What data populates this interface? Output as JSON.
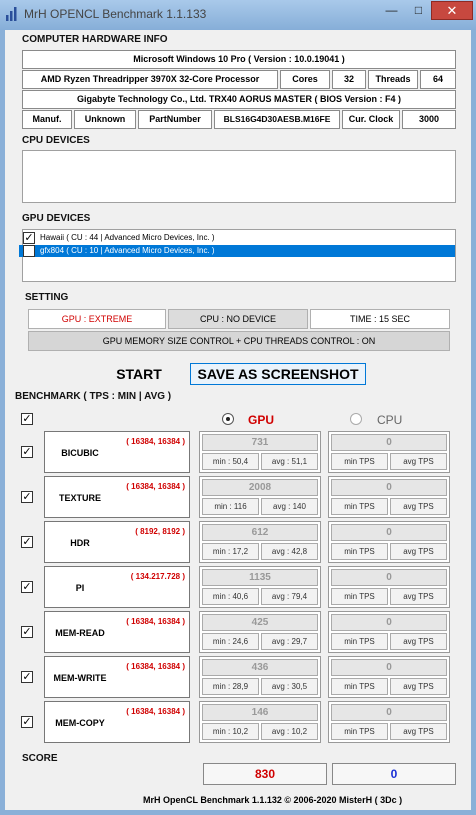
{
  "window": {
    "title": "MrH OPENCL Benchmark 1.1.133",
    "minimize": "—",
    "maximize": "□",
    "close": "✕"
  },
  "hardware": {
    "header": "COMPUTER HARDWARE INFO",
    "os": "Microsoft Windows 10 Pro ( Version : 10.0.19041 )",
    "cpu_name": "AMD Ryzen Threadripper 3970X 32-Core Processor",
    "cores_label": "Cores",
    "cores_value": "32",
    "threads_label": "Threads",
    "threads_value": "64",
    "board": "Gigabyte Technology Co., Ltd. TRX40 AORUS MASTER ( BIOS Version : F4 )",
    "manuf_label": "Manuf.",
    "manuf_value": "Unknown",
    "partnumber_label": "PartNumber",
    "partnumber_value": "BLS16G4D30AESB.M16FE",
    "clock_label": "Cur. Clock",
    "clock_value": "3000"
  },
  "cpu_devices": {
    "header": "CPU DEVICES"
  },
  "gpu_devices": {
    "header": "GPU DEVICES",
    "items": [
      {
        "label": "Hawaii ( CU : 44 | Advanced Micro Devices, Inc. )",
        "checked": true
      },
      {
        "label": "gfx804 ( CU : 10 | Advanced Micro Devices, Inc. )",
        "checked": false
      }
    ]
  },
  "setting": {
    "header": "SETTING",
    "gpu_mode": "GPU : EXTREME",
    "cpu_mode": "CPU : NO DEVICE",
    "time": "TIME : 15 SEC",
    "memory_control": "GPU MEMORY SIZE CONTROL + CPU THREADS CONTROL : ON"
  },
  "actions": {
    "start": "START",
    "screenshot": "SAVE AS SCREENSHOT"
  },
  "benchmark": {
    "header": "BENCHMARK ( TPS : MIN | AVG )",
    "gpu_label": "GPU",
    "cpu_label": "CPU",
    "gpu_selected": true,
    "tests": [
      {
        "name": "BICUBIC",
        "res": "( 16384, 16384 )",
        "gpu": {
          "value": "731",
          "min": "min : 50,4",
          "avg": "avg : 51,1"
        },
        "cpu": {
          "value": "0",
          "min": "min TPS",
          "avg": "avg TPS"
        }
      },
      {
        "name": "TEXTURE",
        "res": "( 16384, 16384 )",
        "gpu": {
          "value": "2008",
          "min": "min : 116",
          "avg": "avg : 140"
        },
        "cpu": {
          "value": "0",
          "min": "min TPS",
          "avg": "avg TPS"
        }
      },
      {
        "name": "HDR",
        "res": "( 8192, 8192 )",
        "gpu": {
          "value": "612",
          "min": "min : 17,2",
          "avg": "avg : 42,8"
        },
        "cpu": {
          "value": "0",
          "min": "min TPS",
          "avg": "avg TPS"
        }
      },
      {
        "name": "PI",
        "res": "( 134.217.728 )",
        "gpu": {
          "value": "1135",
          "min": "min : 40,6",
          "avg": "avg : 79,4"
        },
        "cpu": {
          "value": "0",
          "min": "min TPS",
          "avg": "avg TPS"
        }
      },
      {
        "name": "MEM-READ",
        "res": "( 16384, 16384 )",
        "gpu": {
          "value": "425",
          "min": "min : 24,6",
          "avg": "avg : 29,7"
        },
        "cpu": {
          "value": "0",
          "min": "min TPS",
          "avg": "avg TPS"
        }
      },
      {
        "name": "MEM-WRITE",
        "res": "( 16384, 16384 )",
        "gpu": {
          "value": "436",
          "min": "min : 28,9",
          "avg": "avg : 30,5"
        },
        "cpu": {
          "value": "0",
          "min": "min TPS",
          "avg": "avg TPS"
        }
      },
      {
        "name": "MEM-COPY",
        "res": "( 16384, 16384 )",
        "gpu": {
          "value": "146",
          "min": "min : 10,2",
          "avg": "avg : 10,2"
        },
        "cpu": {
          "value": "0",
          "min": "min TPS",
          "avg": "avg TPS"
        }
      }
    ]
  },
  "score": {
    "header": "SCORE",
    "gpu": "830",
    "cpu": "0"
  },
  "footer": "MrH OpenCL Benchmark 1.1.132  ©  2006-2020 MisterH ( 3Dc )",
  "colors": {
    "accent_red": "#d00000",
    "cpu_score_blue": "#1a2fd6",
    "selection_blue": "#0078d7"
  }
}
